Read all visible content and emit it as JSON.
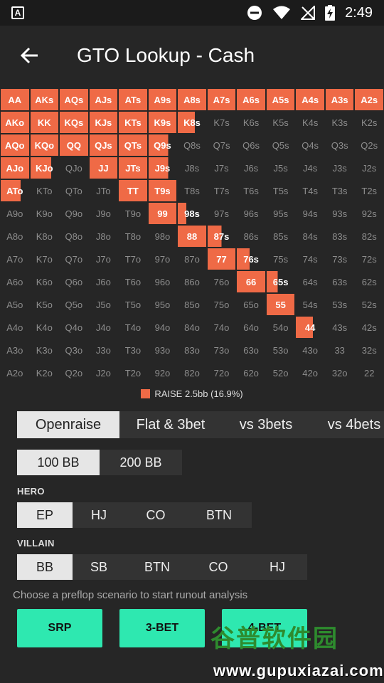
{
  "status_bar": {
    "time": "2:49",
    "app_icon_letter": "A"
  },
  "app_bar": {
    "title": "GTO Lookup - Cash"
  },
  "grid": {
    "rows": [
      [
        "AA",
        "AKs",
        "AQs",
        "AJs",
        "ATs",
        "A9s",
        "A8s",
        "A7s",
        "A6s",
        "A5s",
        "A4s",
        "A3s",
        "A2s"
      ],
      [
        "AKo",
        "KK",
        "KQs",
        "KJs",
        "KTs",
        "K9s",
        "K8s",
        "K7s",
        "K6s",
        "K5s",
        "K4s",
        "K3s",
        "K2s"
      ],
      [
        "AQo",
        "KQo",
        "QQ",
        "QJs",
        "QTs",
        "Q9s",
        "Q8s",
        "Q7s",
        "Q6s",
        "Q5s",
        "Q4s",
        "Q3s",
        "Q2s"
      ],
      [
        "AJo",
        "KJo",
        "QJo",
        "JJ",
        "JTs",
        "J9s",
        "J8s",
        "J7s",
        "J6s",
        "J5s",
        "J4s",
        "J3s",
        "J2s"
      ],
      [
        "ATo",
        "KTo",
        "QTo",
        "JTo",
        "TT",
        "T9s",
        "T8s",
        "T7s",
        "T6s",
        "T5s",
        "T4s",
        "T3s",
        "T2s"
      ],
      [
        "A9o",
        "K9o",
        "Q9o",
        "J9o",
        "T9o",
        "99",
        "98s",
        "97s",
        "96s",
        "95s",
        "94s",
        "93s",
        "92s"
      ],
      [
        "A8o",
        "K8o",
        "Q8o",
        "J8o",
        "T8o",
        "98o",
        "88",
        "87s",
        "86s",
        "85s",
        "84s",
        "83s",
        "82s"
      ],
      [
        "A7o",
        "K7o",
        "Q7o",
        "J7o",
        "T7o",
        "97o",
        "87o",
        "77",
        "76s",
        "75s",
        "74s",
        "73s",
        "72s"
      ],
      [
        "A6o",
        "K6o",
        "Q6o",
        "J6o",
        "T6o",
        "96o",
        "86o",
        "76o",
        "66",
        "65s",
        "64s",
        "63s",
        "62s"
      ],
      [
        "A5o",
        "K5o",
        "Q5o",
        "J5o",
        "T5o",
        "95o",
        "85o",
        "75o",
        "65o",
        "55",
        "54s",
        "53s",
        "52s"
      ],
      [
        "A4o",
        "K4o",
        "Q4o",
        "J4o",
        "T4o",
        "94o",
        "84o",
        "74o",
        "64o",
        "54o",
        "44",
        "43s",
        "42s"
      ],
      [
        "A3o",
        "K3o",
        "Q3o",
        "J3o",
        "T3o",
        "93o",
        "83o",
        "73o",
        "63o",
        "53o",
        "43o",
        "33",
        "32s"
      ],
      [
        "A2o",
        "K2o",
        "Q2o",
        "J2o",
        "T2o",
        "92o",
        "82o",
        "72o",
        "62o",
        "52o",
        "42o",
        "32o",
        "22"
      ]
    ],
    "raise_frequency": {
      "AA": 1,
      "AKs": 1,
      "AQs": 1,
      "AJs": 1,
      "ATs": 1,
      "A9s": 1,
      "A8s": 1,
      "A7s": 1,
      "A6s": 1,
      "A5s": 1,
      "A4s": 1,
      "A3s": 1,
      "A2s": 1,
      "AKo": 1,
      "KK": 1,
      "KQs": 1,
      "KJs": 1,
      "KTs": 1,
      "K9s": 1,
      "K8s": 0.6,
      "AQo": 1,
      "KQo": 1,
      "QQ": 1,
      "QJs": 1,
      "QTs": 1,
      "Q9s": 0.7,
      "AJo": 1,
      "KJo": 0.75,
      "JJ": 1,
      "JTs": 1,
      "J9s": 0.7,
      "ATo": 0.7,
      "TT": 1,
      "T9s": 1,
      "99": 1,
      "98s": 0.3,
      "88": 1,
      "87s": 0.5,
      "77": 1,
      "76s": 0.45,
      "66": 1,
      "65s": 0.4,
      "55": 1,
      "44": 0.6
    },
    "raise_color": "#ef6a46"
  },
  "legend": {
    "label": "RAISE 2.5bb (16.9%)"
  },
  "main_tabs": [
    {
      "label": "Openraise",
      "active": true
    },
    {
      "label": "Flat & 3bet",
      "active": false
    },
    {
      "label": "vs 3bets",
      "active": false
    },
    {
      "label": "vs 4bets",
      "active": false
    }
  ],
  "stack_tabs": [
    {
      "label": "100 BB",
      "active": true
    },
    {
      "label": "200 BB",
      "active": false
    }
  ],
  "hero": {
    "label": "HERO",
    "options": [
      {
        "label": "EP",
        "active": true
      },
      {
        "label": "HJ",
        "active": false
      },
      {
        "label": "CO",
        "active": false
      },
      {
        "label": "BTN",
        "active": false
      }
    ]
  },
  "villain": {
    "label": "VILLAIN",
    "options": [
      {
        "label": "BB",
        "active": true
      },
      {
        "label": "SB",
        "active": false
      },
      {
        "label": "BTN",
        "active": false
      },
      {
        "label": "CO",
        "active": false
      },
      {
        "label": "HJ",
        "active": false
      }
    ]
  },
  "hint": "Choose a preflop scenario to start runout analysis",
  "buttons": [
    {
      "label": "SRP"
    },
    {
      "label": "3-BET"
    },
    {
      "label": "4-BET"
    }
  ],
  "watermark": {
    "logo": "谷普软件园",
    "url": "www.gupuxiazai.com"
  },
  "accent_color": "#2ee8b0"
}
